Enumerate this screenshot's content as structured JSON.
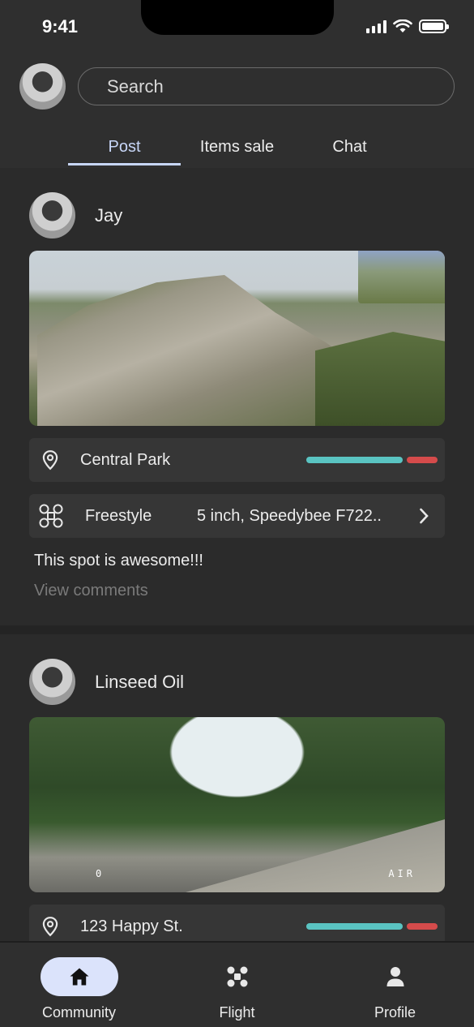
{
  "status": {
    "time": "9:41"
  },
  "header": {
    "search_placeholder": "Search",
    "tabs": [
      {
        "label": "Post",
        "active": true
      },
      {
        "label": "Items sale",
        "active": false
      },
      {
        "label": "Chat",
        "active": false
      }
    ]
  },
  "posts": [
    {
      "user": "Jay",
      "location": "Central Park",
      "style": "Freestyle",
      "spec": "5 inch, Speedybee F722..",
      "caption": "This spot is awesome!!!",
      "comments_link": "View comments"
    },
    {
      "user": "Linseed Oil",
      "location": "123 Happy St.",
      "osd_left": "0",
      "osd_right": "AIR"
    }
  ],
  "bottom_nav": [
    {
      "label": "Community",
      "icon": "home-icon",
      "active": true
    },
    {
      "label": "Flight",
      "icon": "drone-icon",
      "active": false
    },
    {
      "label": "Profile",
      "icon": "person-icon",
      "active": false
    }
  ],
  "colors": {
    "accent": "#c7d6f7",
    "rating_good": "#5ac4c2",
    "rating_bad": "#d54b4b",
    "nav_active": "#dbe3fb"
  }
}
